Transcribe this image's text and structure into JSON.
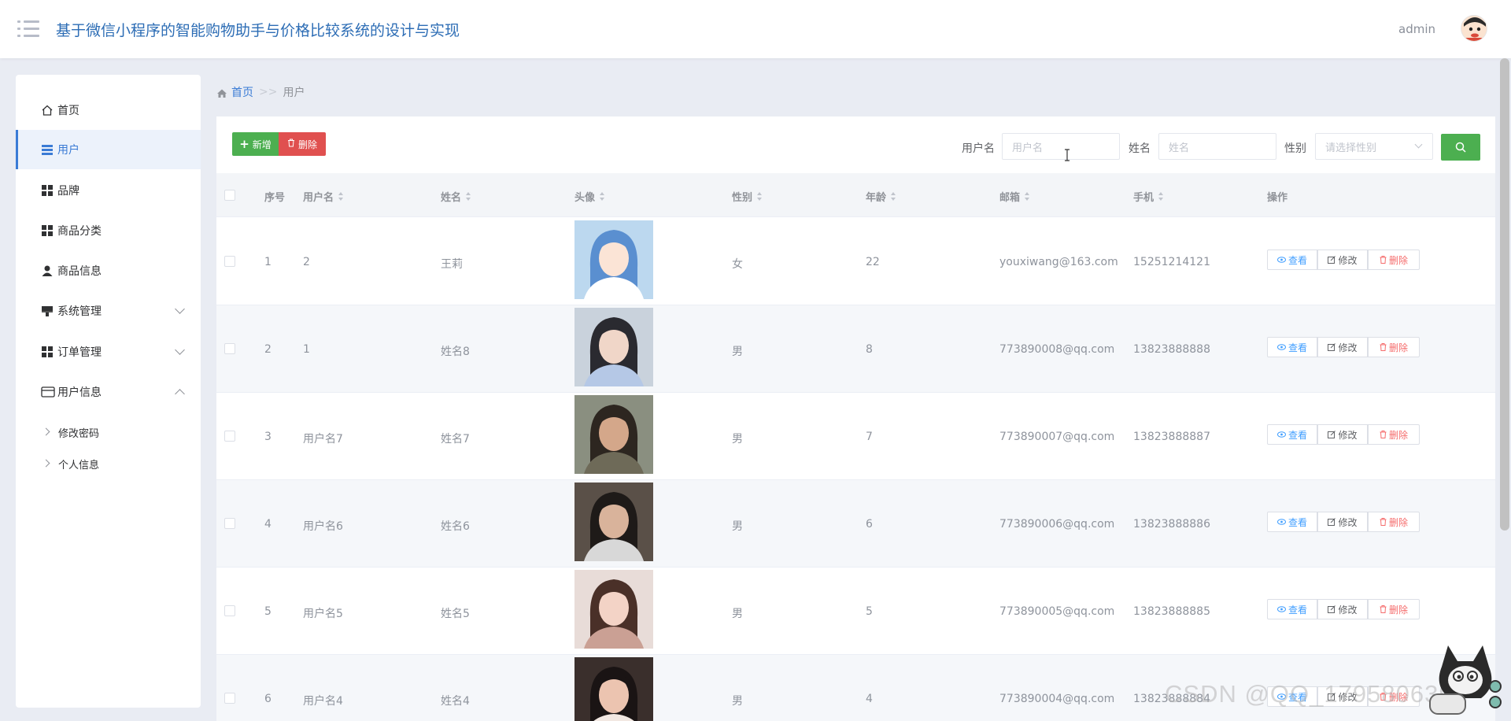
{
  "header": {
    "title": "基于微信小程序的智能购物助手与价格比较系统的设计与实现",
    "username": "admin"
  },
  "sidebar": {
    "items": [
      {
        "label": "首页",
        "icon": "home-icon"
      },
      {
        "label": "用户",
        "icon": "list-icon",
        "active": true
      },
      {
        "label": "品牌",
        "icon": "grid-icon"
      },
      {
        "label": "商品分类",
        "icon": "grid-icon"
      },
      {
        "label": "商品信息",
        "icon": "user-icon"
      },
      {
        "label": "系统管理",
        "icon": "brush-icon",
        "expandable": true
      },
      {
        "label": "订单管理",
        "icon": "grid-icon",
        "expandable": true
      },
      {
        "label": "用户信息",
        "icon": "card-icon",
        "expanded": true
      }
    ],
    "subitems": [
      {
        "label": "修改密码"
      },
      {
        "label": "个人信息"
      }
    ]
  },
  "breadcrumb": {
    "home": "首页",
    "separator": ">>",
    "current": "用户"
  },
  "toolbar": {
    "add_label": "新增",
    "delete_label": "删除"
  },
  "search": {
    "username_label": "用户名",
    "username_placeholder": "用户名",
    "name_label": "姓名",
    "name_placeholder": "姓名",
    "gender_label": "性别",
    "gender_placeholder": "请选择性别"
  },
  "table": {
    "columns": [
      "序号",
      "用户名",
      "姓名",
      "头像",
      "性别",
      "年龄",
      "邮箱",
      "手机",
      "操作"
    ],
    "actions": {
      "view": "查看",
      "edit": "修改",
      "delete": "删除"
    },
    "rows": [
      {
        "index": "1",
        "username": "2",
        "name": "王莉",
        "gender": "女",
        "age": "22",
        "email": "youxiwang@163.com",
        "phone": "15251214121"
      },
      {
        "index": "2",
        "username": "1",
        "name": "姓名8",
        "gender": "男",
        "age": "8",
        "email": "773890008@qq.com",
        "phone": "13823888888"
      },
      {
        "index": "3",
        "username": "用户名7",
        "name": "姓名7",
        "gender": "男",
        "age": "7",
        "email": "773890007@qq.com",
        "phone": "13823888887"
      },
      {
        "index": "4",
        "username": "用户名6",
        "name": "姓名6",
        "gender": "男",
        "age": "6",
        "email": "773890006@qq.com",
        "phone": "13823888886"
      },
      {
        "index": "5",
        "username": "用户名5",
        "name": "姓名5",
        "gender": "男",
        "age": "5",
        "email": "773890005@qq.com",
        "phone": "13823888885"
      },
      {
        "index": "6",
        "username": "用户名4",
        "name": "姓名4",
        "gender": "男",
        "age": "4",
        "email": "773890004@qq.com",
        "phone": "13823888884"
      }
    ]
  },
  "watermark": "CSDN @QQ_1795806396",
  "colors": {
    "primary": "#3a7bd5",
    "success": "#4caf50",
    "danger": "#e0504f"
  }
}
